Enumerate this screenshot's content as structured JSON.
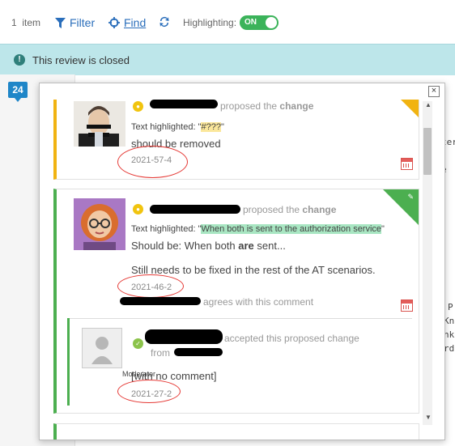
{
  "toolbar": {
    "item_count": "1",
    "item_label": "item",
    "filter_label": "Filter",
    "find_label": "Find",
    "highlighting_label": "Highlighting:",
    "toggle_text": "ON"
  },
  "banner": {
    "text": "This review is closed"
  },
  "comment_badge": {
    "count": "24"
  },
  "background_text": [
    "ter",
    "e -",
    "P",
    "Kn",
    "nk",
    "rd"
  ],
  "popup": {
    "cards": [
      {
        "action": "proposed the",
        "action_bold": "change",
        "highlight_prefix": "Text highlighted: \"",
        "highlight_text": "#???",
        "highlight_suffix": "\"",
        "body": "should be removed",
        "date": "2021-57-4"
      },
      {
        "action": "proposed the",
        "action_bold": "change",
        "highlight_prefix": "Text highlighted: \"",
        "highlight_text": "When both is sent to the authorization service",
        "highlight_suffix": "\"",
        "body_line1_prefix": "Should be: When both ",
        "body_line1_bold": "are",
        "body_line1_suffix": " sent...",
        "body_line2": "Still needs to be fixed in the rest of the AT scenarios.",
        "date": "2021-46-2",
        "reply_action": "agrees with this comment"
      }
    ],
    "reply": {
      "action": "accepted this proposed change",
      "from": "from",
      "role": "Moderator",
      "body": "[with no comment]",
      "date": "2021-27-2"
    }
  },
  "icons": {
    "alert": "exclamation-icon",
    "filter": "funnel-icon",
    "find": "crosshair-icon",
    "refresh": "refresh-icon",
    "close": "close-icon",
    "calendar": "calendar-icon"
  },
  "colors": {
    "banner": "#bde6ea",
    "accent_blue": "#2a6ebb",
    "toggle_on": "#3bb35a",
    "pending": "#f1b311",
    "accepted": "#4caf50",
    "annotation": "#e53935"
  }
}
